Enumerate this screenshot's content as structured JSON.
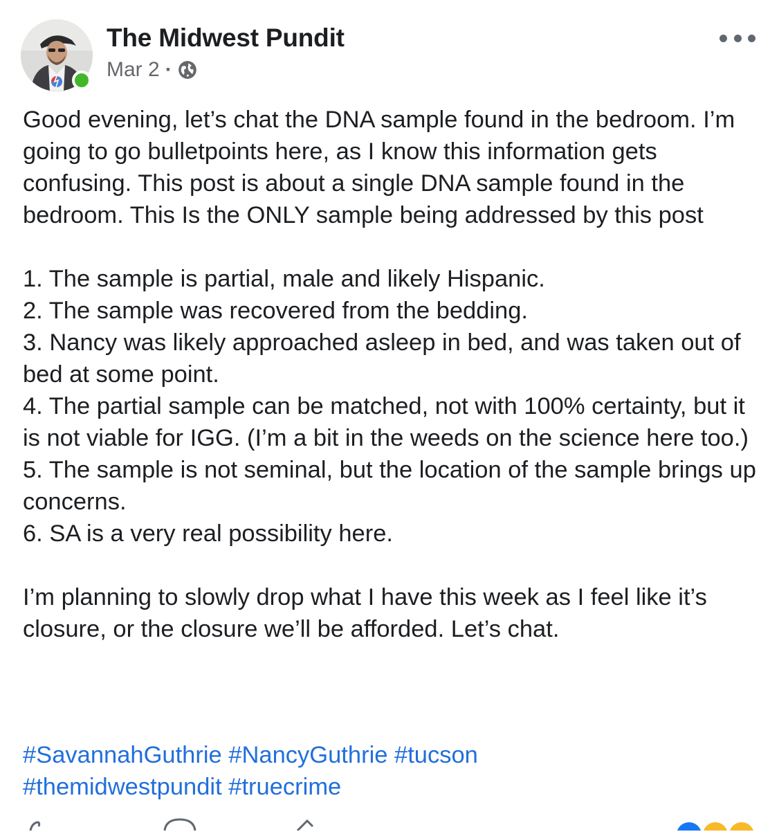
{
  "author": {
    "name": "The Midwest Pundit",
    "date": "Mar 2",
    "separator": "·",
    "privacy_icon": "globe-icon",
    "online": true
  },
  "post": {
    "intro": "Good evening, let’s chat the DNA sample found in the bedroom. I’m going to go bulletpoints here, as I know this information gets confusing. This post is about a single DNA sample found in the bedroom. This Is the ONLY sample being addressed by this post",
    "items": [
      "1. The sample is partial, male and likely Hispanic.",
      "2. The sample was recovered from the bedding.",
      "3. Nancy was likely approached asleep in bed, and was taken out of bed at some point.",
      "4. The partial sample can be matched, not with 100% certainty, but it is not viable for IGG. (I’m a bit in the weeds on the science here too.)",
      "5. The sample is not seminal, but the location of the sample brings up concerns.",
      "6. SA is a very real possibility here."
    ],
    "closing": "I’m planning to slowly drop what I have this week as I feel like it’s closure, or the closure we’ll be afforded. Let’s chat.",
    "hashtags": [
      "#SavannahGuthrie",
      "#NancyGuthrie",
      "#tucson",
      "#themidwestpundit",
      "#truecrime"
    ]
  },
  "colors": {
    "hashtag": "#216fdb",
    "meta": "#65676b",
    "online": "#42b72a",
    "text": "#1c1e21"
  }
}
